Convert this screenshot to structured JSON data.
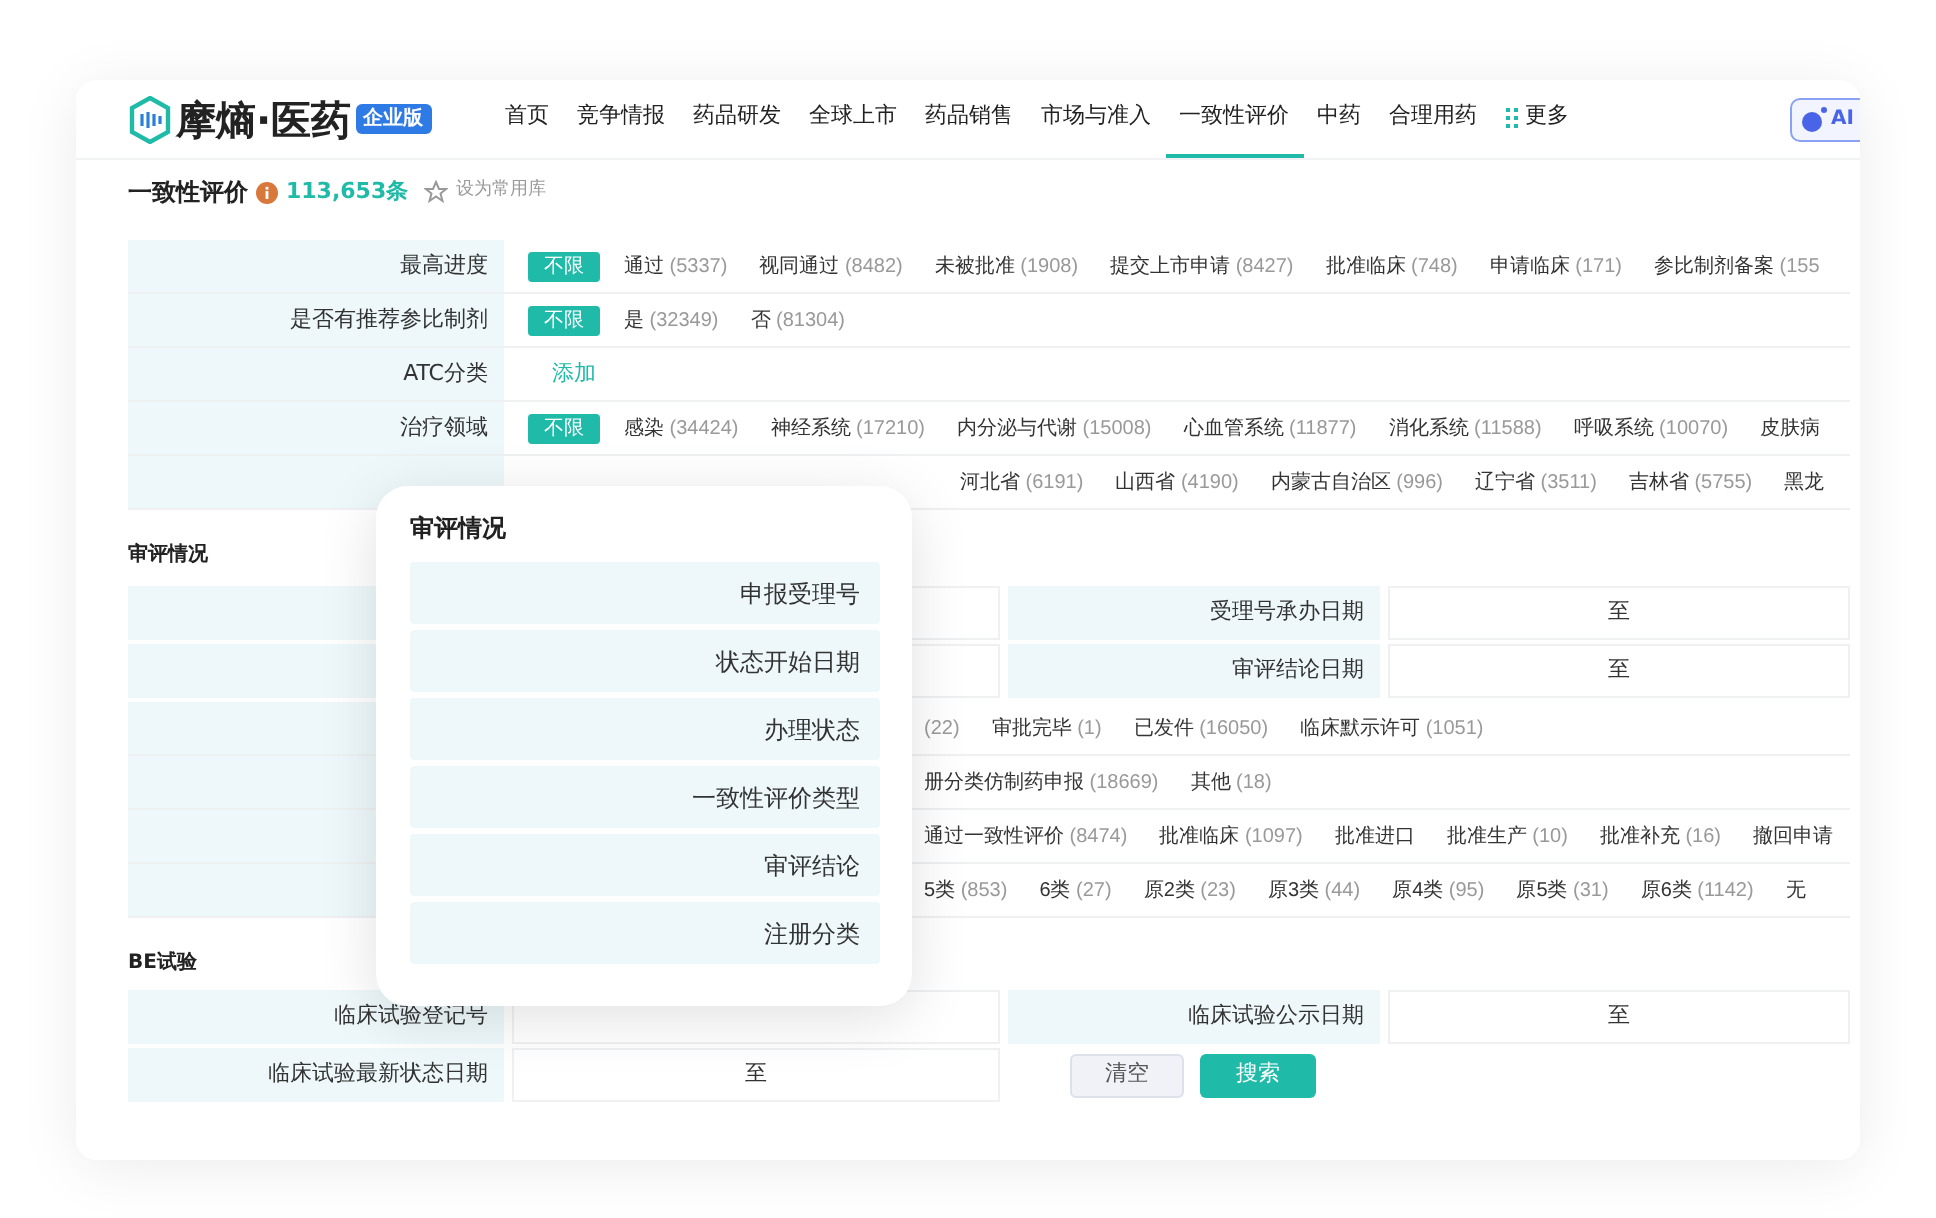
{
  "brand": {
    "name": "摩熵·医药",
    "edition": "企业版"
  },
  "nav": [
    {
      "label": "首页",
      "selected": false
    },
    {
      "label": "竞争情报",
      "selected": false
    },
    {
      "label": "药品研发",
      "selected": false
    },
    {
      "label": "全球上市",
      "selected": false
    },
    {
      "label": "药品销售",
      "selected": false
    },
    {
      "label": "市场与准入",
      "selected": false
    },
    {
      "label": "一致性评价",
      "selected": true
    },
    {
      "label": "中药",
      "selected": false
    },
    {
      "label": "合理用药",
      "selected": false
    },
    {
      "label": "更多",
      "selected": false,
      "kind": "more"
    }
  ],
  "ai_button": "AI",
  "page": {
    "title": "一致性评价",
    "count": "113,653条",
    "favorite": "设为常用库"
  },
  "filters": [
    {
      "label": "最高进度",
      "all": {
        "label": "不限",
        "selected": true
      },
      "options": [
        {
          "label": "通过",
          "count": "(5337)"
        },
        {
          "label": "视同通过",
          "count": "(8482)"
        },
        {
          "label": "未被批准",
          "count": "(1908)"
        },
        {
          "label": "提交上市申请",
          "count": "(8427)"
        },
        {
          "label": "批准临床",
          "count": "(748)"
        },
        {
          "label": "申请临床",
          "count": "(171)"
        },
        {
          "label": "参比制剂备案",
          "count": "(155"
        }
      ]
    },
    {
      "label": "是否有推荐参比制剂",
      "all": {
        "label": "不限",
        "selected": true
      },
      "options": [
        {
          "label": "是",
          "count": "(32349)"
        },
        {
          "label": "否",
          "count": "(81304)"
        }
      ]
    },
    {
      "label": "ATC分类",
      "add": "添加"
    },
    {
      "label": "治疗领域",
      "all": {
        "label": "不限",
        "selected": true
      },
      "options": [
        {
          "label": "感染",
          "count": "(34424)"
        },
        {
          "label": "神经系统",
          "count": "(17210)"
        },
        {
          "label": "内分泌与代谢",
          "count": "(15008)"
        },
        {
          "label": "心血管系统",
          "count": "(11877)"
        },
        {
          "label": "消化系统",
          "count": "(11588)"
        },
        {
          "label": "呼吸系统",
          "count": "(10070)"
        },
        {
          "label": "皮肤病"
        }
      ]
    },
    {
      "options": [
        {
          "label": "河北省",
          "count": "(6191)"
        },
        {
          "label": "山西省",
          "count": "(4190)"
        },
        {
          "label": "内蒙古自治区",
          "count": "(996)"
        },
        {
          "label": "辽宁省",
          "count": "(3511)"
        },
        {
          "label": "吉林省",
          "count": "(5755)"
        },
        {
          "label": "黑龙"
        }
      ]
    }
  ],
  "review": {
    "title": "审评情况",
    "fields": [
      {
        "label": "受理号承办日期",
        "value": "至"
      },
      {
        "label": "审评结论日期",
        "value": "至"
      }
    ],
    "rows": [
      {
        "options": [
          {
            "count": "(22)"
          },
          {
            "label": "审批完毕",
            "count": "(1)"
          },
          {
            "label": "已发件",
            "count": "(16050)"
          },
          {
            "label": "临床默示许可",
            "count": "(1051)"
          }
        ]
      },
      {
        "options": [
          {
            "label": "册分类仿制药申报",
            "count": "(18669)"
          },
          {
            "label": "其他",
            "count": "(18)"
          }
        ]
      },
      {
        "options": [
          {
            "label": "通过一致性评价",
            "count": "(8474)"
          },
          {
            "label": "批准临床",
            "count": "(1097)"
          },
          {
            "label": "批准进口"
          },
          {
            "label": "批准生产",
            "count": "(10)"
          },
          {
            "label": "批准补充",
            "count": "(16)"
          },
          {
            "label": "撤回申请"
          }
        ]
      },
      {
        "options": [
          {
            "label": "5类",
            "count": "(853)"
          },
          {
            "label": "6类",
            "count": "(27)"
          },
          {
            "label": "原2类",
            "count": "(23)"
          },
          {
            "label": "原3类",
            "count": "(44)"
          },
          {
            "label": "原4类",
            "count": "(95)"
          },
          {
            "label": "原5类",
            "count": "(31)"
          },
          {
            "label": "原6类",
            "count": "(1142)"
          },
          {
            "label": "无"
          }
        ]
      }
    ]
  },
  "be": {
    "title": "BE试验",
    "fields": [
      {
        "label": "临床试验登记号"
      },
      {
        "label": "临床试验公示日期",
        "value": "至"
      }
    ],
    "last": {
      "label": "临床试验最新状态日期",
      "value": "至"
    }
  },
  "buttons": {
    "clear": "清空",
    "search": "搜索"
  },
  "popup": {
    "title": "审评情况",
    "items": [
      "申报受理号",
      "状态开始日期",
      "办理状态",
      "一致性评价类型",
      "审评结论",
      "注册分类"
    ]
  }
}
